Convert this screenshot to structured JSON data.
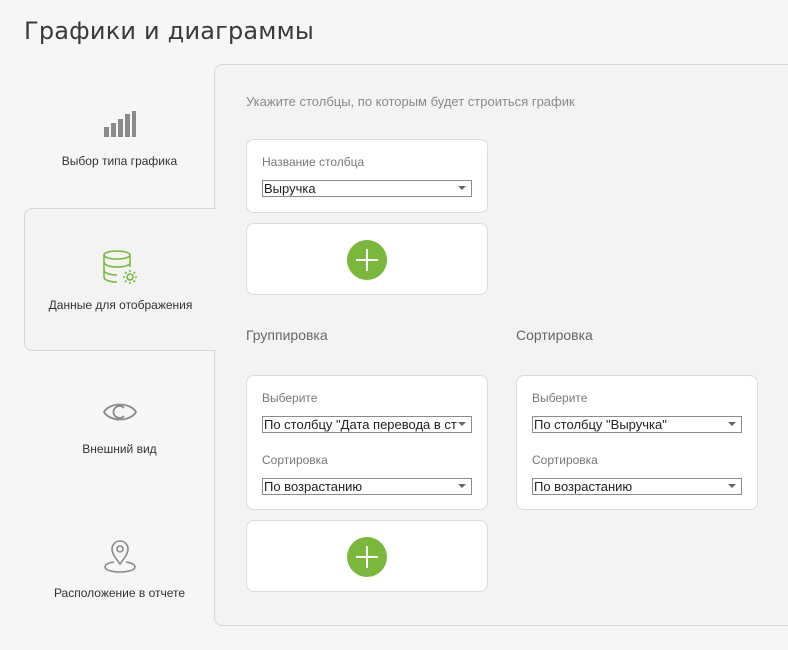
{
  "page": {
    "title": "Графики и диаграммы"
  },
  "tabs": [
    {
      "label": "Выбор типа графика",
      "icon": "bar-chart-icon"
    },
    {
      "label": "Данные для отображения",
      "icon": "database-settings-icon"
    },
    {
      "label": "Внешний вид",
      "icon": "eye-icon"
    },
    {
      "label": "Расположение в отчете",
      "icon": "location-pin-icon"
    }
  ],
  "main": {
    "hint": "Укажите столбцы, по которым будет строиться график",
    "column_card": {
      "label": "Название столбца",
      "value": "Выручка"
    },
    "grouping": {
      "title": "Группировка",
      "select_label": "Выберите",
      "select_value": "По столбцу \"Дата перевода в ст",
      "sort_label": "Сортировка",
      "sort_value": "По возрастанию"
    },
    "sorting": {
      "title": "Сортировка",
      "select_label": "Выберите",
      "select_value": "По столбцу \"Выручка\"",
      "sort_label": "Сортировка",
      "sort_value": "По возрастанию"
    }
  },
  "colors": {
    "accent": "#7ab83b",
    "active_icon": "#7ab83b",
    "inactive_icon": "#888888"
  }
}
